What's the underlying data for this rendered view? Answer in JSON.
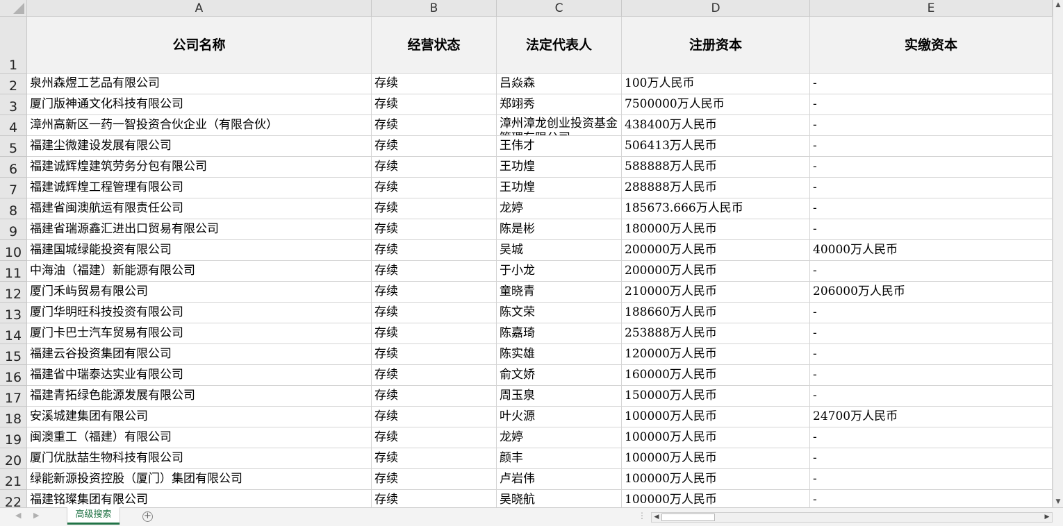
{
  "columns": [
    "A",
    "B",
    "C",
    "D",
    "E"
  ],
  "header_row": {
    "row_number": "1",
    "cells": [
      "公司名称",
      "经营状态",
      "法定代表人",
      "注册资本",
      "实缴资本"
    ]
  },
  "rows": [
    {
      "n": "2",
      "cells": [
        "泉州森煜工艺品有限公司",
        "存续",
        "吕焱森",
        "100万人民币",
        "-"
      ]
    },
    {
      "n": "3",
      "cells": [
        "厦门版神通文化科技有限公司",
        "存续",
        "郑翊秀",
        "7500000万人民币",
        "-"
      ]
    },
    {
      "n": "4",
      "cells": [
        "漳州高新区一药一智投资合伙企业（有限合伙）",
        "存续",
        "漳州漳龙创业投资基金管理有限公司",
        "438400万人民币",
        "-"
      ]
    },
    {
      "n": "5",
      "cells": [
        "福建尘微建设发展有限公司",
        "存续",
        "王伟才",
        "506413万人民币",
        "-"
      ]
    },
    {
      "n": "6",
      "cells": [
        "福建诚辉煌建筑劳务分包有限公司",
        "存续",
        "王功煌",
        "588888万人民币",
        "-"
      ]
    },
    {
      "n": "7",
      "cells": [
        "福建诚辉煌工程管理有限公司",
        "存续",
        "王功煌",
        "288888万人民币",
        "-"
      ]
    },
    {
      "n": "8",
      "cells": [
        "福建省闽澳航运有限责任公司",
        "存续",
        "龙婷",
        "185673.666万人民币",
        "-"
      ]
    },
    {
      "n": "9",
      "cells": [
        "福建省瑞源鑫汇进出口贸易有限公司",
        "存续",
        "陈是彬",
        "180000万人民币",
        "-"
      ]
    },
    {
      "n": "10",
      "cells": [
        "福建国城绿能投资有限公司",
        "存续",
        "吴城",
        "200000万人民币",
        "40000万人民币"
      ]
    },
    {
      "n": "11",
      "cells": [
        "中海油（福建）新能源有限公司",
        "存续",
        "于小龙",
        "200000万人民币",
        "-"
      ]
    },
    {
      "n": "12",
      "cells": [
        "厦门禾屿贸易有限公司",
        "存续",
        "童晓青",
        "210000万人民币",
        "206000万人民币"
      ]
    },
    {
      "n": "13",
      "cells": [
        "厦门华明旺科技投资有限公司",
        "存续",
        "陈文荣",
        "188660万人民币",
        "-"
      ]
    },
    {
      "n": "14",
      "cells": [
        "厦门卡巴士汽车贸易有限公司",
        "存续",
        "陈嘉琦",
        "253888万人民币",
        "-"
      ]
    },
    {
      "n": "15",
      "cells": [
        "福建云谷投资集团有限公司",
        "存续",
        "陈实雄",
        "120000万人民币",
        "-"
      ]
    },
    {
      "n": "16",
      "cells": [
        "福建省中瑞泰达实业有限公司",
        "存续",
        "俞文娇",
        "160000万人民币",
        "-"
      ]
    },
    {
      "n": "17",
      "cells": [
        "福建青拓绿色能源发展有限公司",
        "存续",
        "周玉泉",
        "150000万人民币",
        "-"
      ]
    },
    {
      "n": "18",
      "cells": [
        "安溪城建集团有限公司",
        "存续",
        "叶火源",
        "100000万人民币",
        "24700万人民币"
      ]
    },
    {
      "n": "19",
      "cells": [
        "闽澳重工（福建）有限公司",
        "存续",
        "龙婷",
        "100000万人民币",
        "-"
      ]
    },
    {
      "n": "20",
      "cells": [
        "厦门优肽喆生物科技有限公司",
        "存续",
        "颜丰",
        "100000万人民币",
        "-"
      ]
    },
    {
      "n": "21",
      "cells": [
        "绿能新源投资控股（厦门）集团有限公司",
        "存续",
        "卢岩伟",
        "100000万人民币",
        "-"
      ]
    },
    {
      "n": "22",
      "cells": [
        "福建铭璨集团有限公司",
        "存续",
        "吴晓航",
        "100000万人民币",
        "-"
      ]
    }
  ],
  "sheet_tab": {
    "label": "高级搜索"
  },
  "icons": {
    "add_sheet": "plus-circle-icon",
    "scroll_up": "triangle-up-icon",
    "scroll_down": "triangle-down-icon",
    "scroll_left": "triangle-left-icon",
    "scroll_right": "triangle-right-icon"
  },
  "colors": {
    "accent": "#217346",
    "header_bg": "#e6e6e6"
  }
}
